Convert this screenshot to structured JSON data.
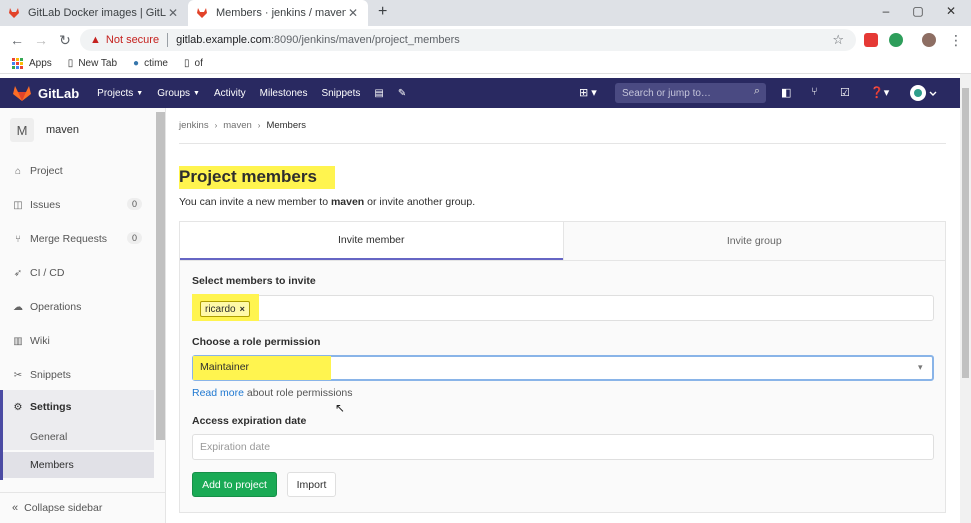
{
  "browser": {
    "tabs": [
      {
        "label": "GitLab Docker images | GitLab"
      },
      {
        "label": "Members · jenkins / maven · GitL"
      }
    ],
    "new_tab": "+",
    "window_controls": [
      "–",
      "▢",
      "✕"
    ],
    "security_label": "Not secure",
    "url_host": "gitlab.example.com",
    "url_rest": ":8090/jenkins/maven/project_members",
    "bookmarks": [
      {
        "label": "Apps"
      },
      {
        "label": "New Tab"
      },
      {
        "label": "ctime"
      },
      {
        "label": "of"
      }
    ]
  },
  "gitlab": {
    "brand": "GitLab",
    "nav": [
      {
        "label": "Projects",
        "dropdown": true
      },
      {
        "label": "Groups",
        "dropdown": true
      },
      {
        "label": "Activity",
        "dropdown": false
      },
      {
        "label": "Milestones",
        "dropdown": false
      },
      {
        "label": "Snippets",
        "dropdown": false
      }
    ],
    "search_placeholder": "Search or jump to…",
    "header_color": "#292961"
  },
  "sidebar": {
    "project_initial": "M",
    "project_name": "maven",
    "items": [
      {
        "label": "Project",
        "icon": "home-icon",
        "count": null
      },
      {
        "label": "Issues",
        "icon": "issues-icon",
        "count": "0"
      },
      {
        "label": "Merge Requests",
        "icon": "merge-request-icon",
        "count": "0"
      },
      {
        "label": "CI / CD",
        "icon": "rocket-icon",
        "count": null
      },
      {
        "label": "Operations",
        "icon": "cloud-gear-icon",
        "count": null
      },
      {
        "label": "Wiki",
        "icon": "book-icon",
        "count": null
      },
      {
        "label": "Snippets",
        "icon": "scissors-icon",
        "count": null
      },
      {
        "label": "Settings",
        "icon": "gear-icon",
        "count": null
      }
    ],
    "sub_items": [
      {
        "label": "General"
      },
      {
        "label": "Members"
      }
    ],
    "collapse_label": "Collapse sidebar"
  },
  "main": {
    "breadcrumb": [
      "jenkins",
      "maven",
      "Members"
    ],
    "title": "Project members",
    "desc_prefix": "You can invite a new member to ",
    "desc_project": "maven",
    "desc_suffix": " or invite another group.",
    "tabs": [
      {
        "label": "Invite member",
        "active": true
      },
      {
        "label": "Invite group",
        "active": false
      }
    ],
    "form": {
      "members_label": "Select members to invite",
      "members_token": "ricardo",
      "role_label": "Choose a role permission",
      "role_value": "Maintainer",
      "read_more_link": "Read more",
      "read_more_suffix": " about role permissions",
      "expiration_label": "Access expiration date",
      "expiration_placeholder": "Expiration date",
      "add_button": "Add to project",
      "import_button": "Import"
    }
  }
}
